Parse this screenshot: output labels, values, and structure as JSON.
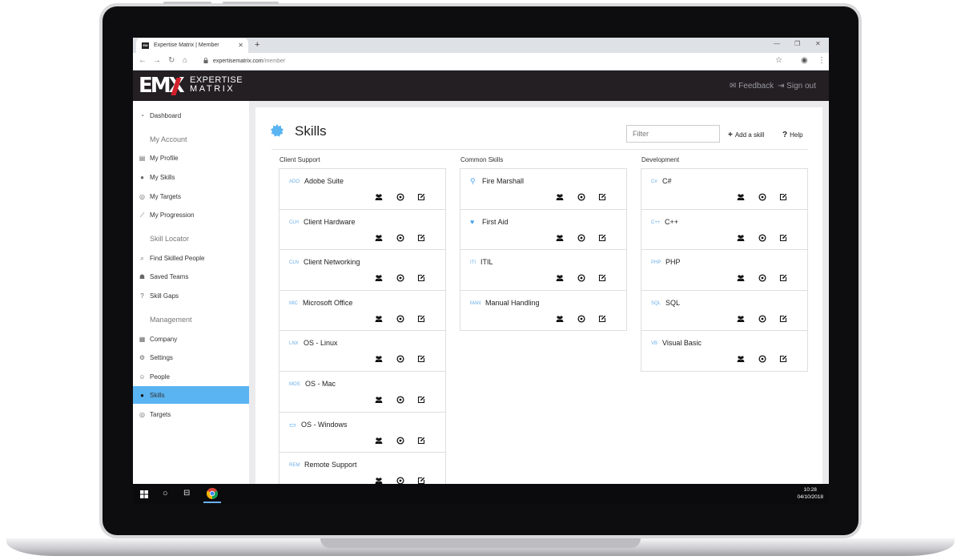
{
  "browser": {
    "tab_title": "Expertise Matrix | Member",
    "tab_favicon": "EM",
    "url_domain": "expertisematrix.com",
    "url_path": "/member"
  },
  "header": {
    "logo_mark": "EMX",
    "logo_line1": "EXPERTISE",
    "logo_line2": "MATRIX",
    "feedback_label": "Feedback",
    "signout_label": "Sign out"
  },
  "sidebar": {
    "dashboard": "Dashboard",
    "sections": [
      {
        "title": "My Account",
        "items": [
          "My Profile",
          "My Skills",
          "My Targets",
          "My Progression"
        ]
      },
      {
        "title": "Skill Locator",
        "items": [
          "Find Skilled People",
          "Saved Teams",
          "Skill Gaps"
        ]
      },
      {
        "title": "Management",
        "items": [
          "Company",
          "Settings",
          "People",
          "Skills",
          "Targets"
        ]
      }
    ],
    "active_item": "Skills"
  },
  "main": {
    "title": "Skills",
    "filter_placeholder": "Filter",
    "add_skill_label": "Add a skill",
    "help_label": "Help",
    "columns": [
      {
        "heading": "Client Support",
        "skills": [
          {
            "code": "ADO",
            "name": "Adobe Suite"
          },
          {
            "code": "CLH",
            "name": "Client Hardware"
          },
          {
            "code": "CLN",
            "name": "Client Networking"
          },
          {
            "code": "MIC",
            "name": "Microsoft Office"
          },
          {
            "code": "LNX",
            "name": "OS - Linux"
          },
          {
            "code": "MOS",
            "name": "OS - Mac"
          },
          {
            "code": "",
            "icon": "window-icon",
            "name": "OS - Windows"
          },
          {
            "code": "REM",
            "name": "Remote Support"
          }
        ]
      },
      {
        "heading": "Common Skills",
        "skills": [
          {
            "code": "",
            "icon": "fire-extinguisher-icon",
            "name": "Fire Marshall"
          },
          {
            "code": "",
            "icon": "heartbeat-icon",
            "name": "First Aid"
          },
          {
            "code": "ITI",
            "name": "ITIL"
          },
          {
            "code": "MAN",
            "name": "Manual Handling"
          }
        ]
      },
      {
        "heading": "Development",
        "skills": [
          {
            "code": "C#",
            "name": "C#"
          },
          {
            "code": "C++",
            "name": "C++"
          },
          {
            "code": "PHP",
            "name": "PHP"
          },
          {
            "code": "SQL",
            "name": "SQL"
          },
          {
            "code": "VB",
            "name": "Visual Basic"
          }
        ]
      }
    ]
  },
  "taskbar": {
    "time": "10:28",
    "date": "04/10/2018"
  },
  "colors": {
    "header_bg": "#231f23",
    "accent_blue": "#5ab4f2",
    "logo_red": "#d21f2c",
    "code_blue": "#6aaee8"
  }
}
